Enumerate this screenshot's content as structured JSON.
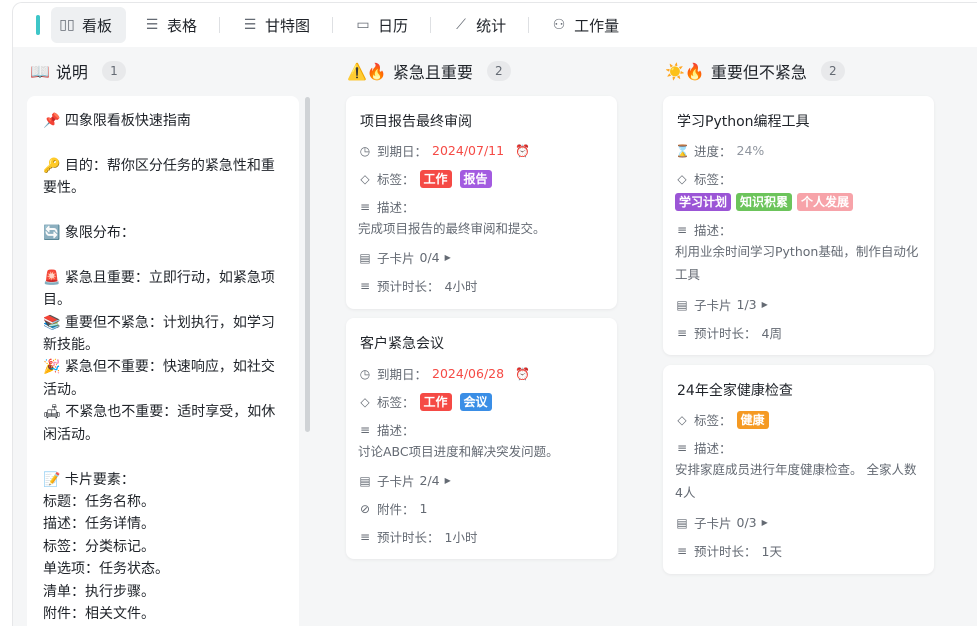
{
  "toolbar": {
    "tabs": [
      {
        "label": "看板",
        "icon": "kanban-icon",
        "glyph": "▯▯"
      },
      {
        "label": "表格",
        "icon": "list-icon",
        "glyph": "☰"
      },
      {
        "label": "甘特图",
        "icon": "gantt-icon",
        "glyph": "☰"
      },
      {
        "label": "日历",
        "icon": "calendar-icon",
        "glyph": "▭"
      },
      {
        "label": "统计",
        "icon": "chart-icon",
        "glyph": "⟋"
      },
      {
        "label": "工作量",
        "icon": "people-icon",
        "glyph": "⚇"
      }
    ]
  },
  "columns": {
    "c1": {
      "emoji": "📖",
      "title": "说明",
      "count": "1"
    },
    "c2": {
      "emoji": "⚠️🔥",
      "title": "紧急且重要",
      "count": "2"
    },
    "c3": {
      "emoji": "☀️🔥",
      "title": "重要但不紧急",
      "count": "2"
    }
  },
  "note": {
    "text": "📌 四象限看板快速指南\n\n🔑 目的：帮你区分任务的紧急性和重要性。\n\n🔄 象限分布：\n\n🚨 紧急且重要：立即行动，如紧急项目。\n📚 重要但不紧急：计划执行，如学习新技能。\n🎉 紧急但不重要：快速响应，如社交活动。\n🛋 不紧急也不重要：适时享受，如休闲活动。\n\n📝 卡片要素：\n标题：任务名称。\n描述：任务详情。\n标签：分类标记。\n单选项：任务状态。\n清单：执行步骤。\n附件：相关文件。"
  },
  "labels": {
    "due": "到期日：",
    "tags": "标签：",
    "desc": "描述：",
    "sub": "子卡片",
    "est": "预计时长：",
    "attach": "附件：",
    "progress": "进度："
  },
  "cards": {
    "a": {
      "title": "项目报告最终审阅",
      "due": "2024/07/11",
      "tags": [
        "工作",
        "报告"
      ],
      "desc": "完成项目报告的最终审阅和提交。",
      "sub": "0/4",
      "est": "4小时"
    },
    "b": {
      "title": "客户紧急会议",
      "due": "2024/06/28",
      "tags": [
        "工作",
        "会议"
      ],
      "desc": "讨论ABC项目进度和解决突发问题。",
      "sub": "2/4",
      "attach": "1",
      "est": "1小时"
    },
    "c": {
      "title": "学习Python编程工具",
      "progress": "24%",
      "tags": [
        "学习计划",
        "知识积累",
        "个人发展"
      ],
      "desc": "利用业余时间学习Python基础，制作自动化工具",
      "sub": "1/3",
      "est": "4周"
    },
    "d": {
      "title": "24年全家健康检查",
      "tags": [
        "健康"
      ],
      "desc": "安排家庭成员进行年度健康检查。 全家人数4人",
      "sub": "0/3",
      "est": "1天"
    }
  },
  "tag_colors": {
    "工作": "#f54a45",
    "报告": "#a35be0",
    "会议": "#3a8ee6",
    "学习计划": "#9b55d6",
    "知识积累": "#6cc45b",
    "个人发展": "#f7a3a9",
    "健康": "#f59a23"
  }
}
